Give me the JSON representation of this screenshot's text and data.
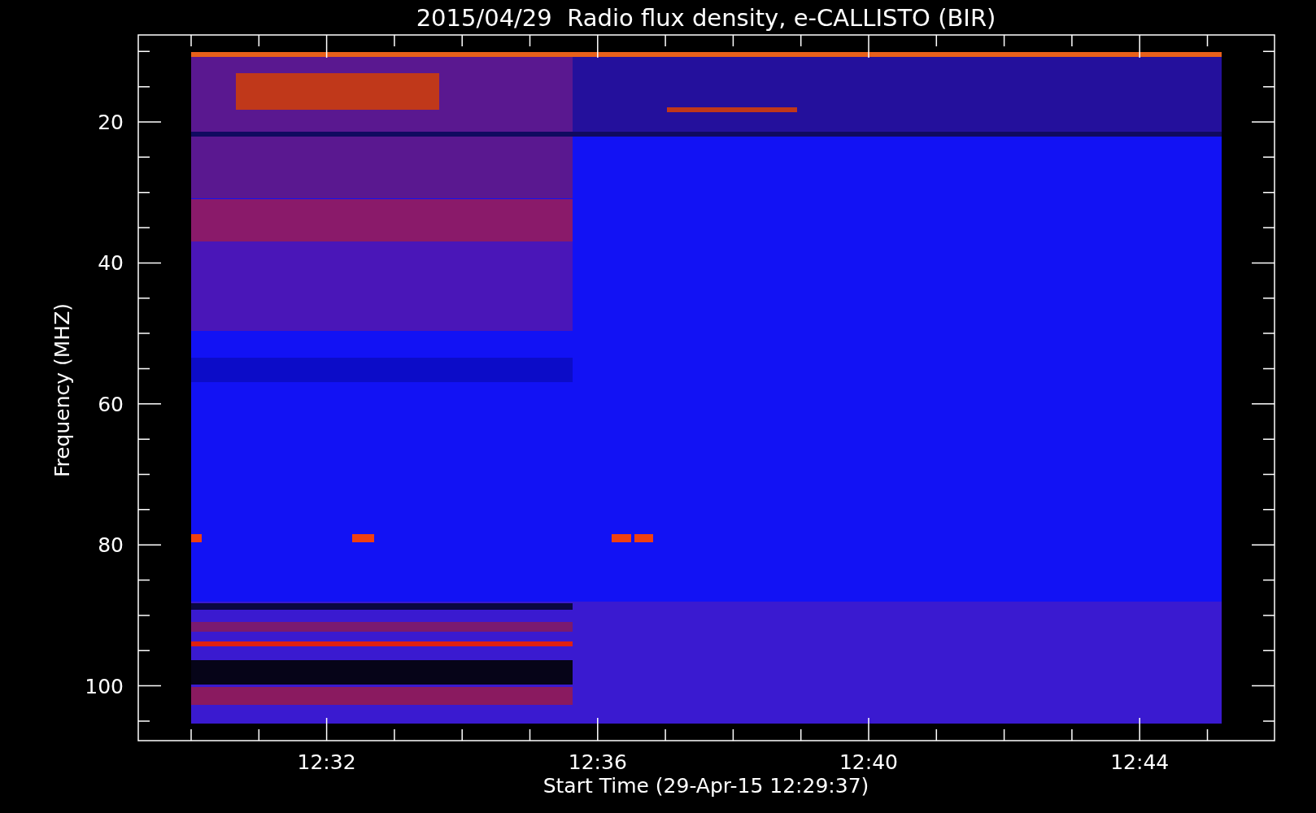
{
  "title": "2015/04/29  Radio flux density, e-CALLISTO (BIR)",
  "plot": {
    "ylabel": "Frequency (MHZ)",
    "xlabel": "Start Time (29-Apr-15 12:29:37)",
    "yticks": [
      "20",
      "40",
      "60",
      "80",
      "100"
    ],
    "xticks": [
      "12:32",
      "12:36",
      "12:40",
      "12:44"
    ]
  }
}
